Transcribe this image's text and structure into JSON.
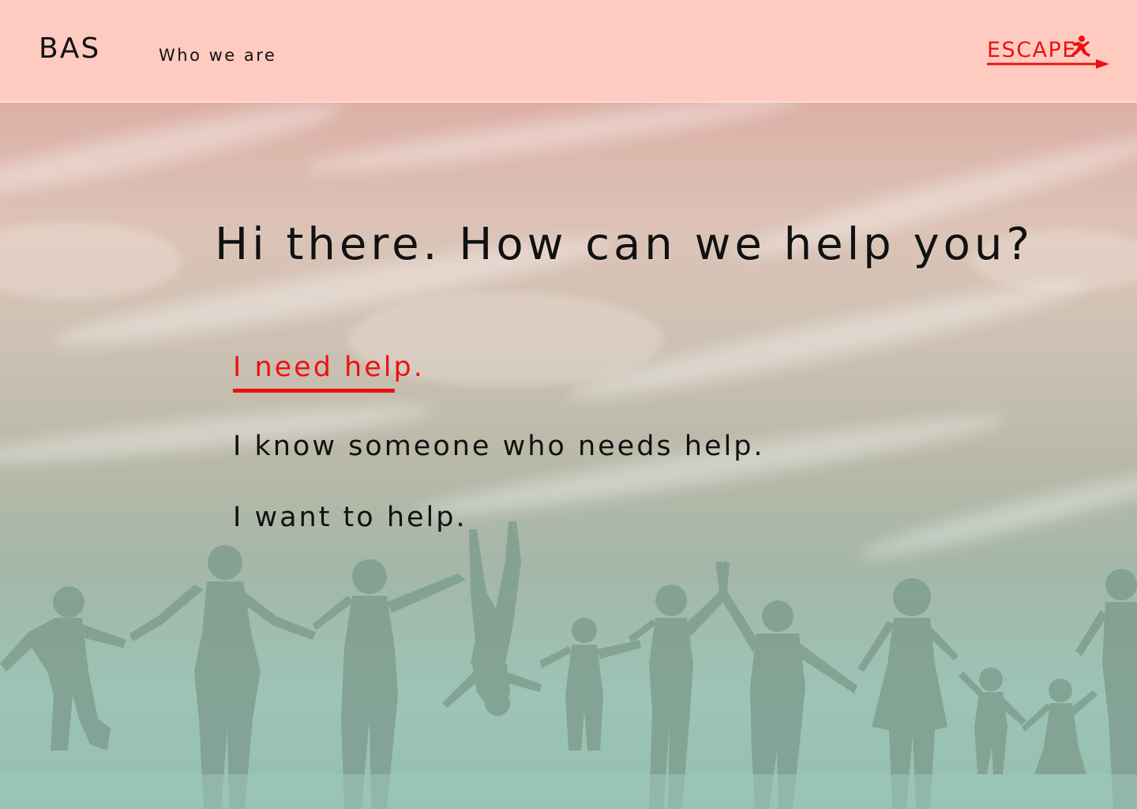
{
  "header": {
    "brand": "BAS",
    "nav": [
      {
        "label": "Who we are"
      }
    ],
    "escape_label": "ESCAPE"
  },
  "hero": {
    "headline": "Hi there. How can we help you?",
    "options": [
      {
        "label": "I need help.",
        "active": true
      },
      {
        "label": "I know someone who needs help.",
        "active": false
      },
      {
        "label": "I want to help.",
        "active": false
      }
    ]
  },
  "colors": {
    "header_bg": "#ffcbc0",
    "accent": "#ee1111",
    "text": "#111111",
    "silhouette": "#7f9e90"
  },
  "icons": {
    "escape_runner": "running-figure-icon",
    "escape_arrow": "arrow-right-icon"
  }
}
